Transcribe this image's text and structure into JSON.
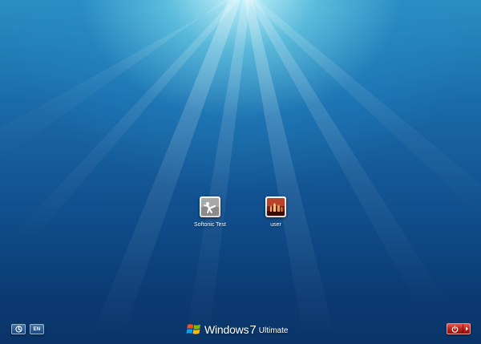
{
  "users": [
    {
      "name": "Softonic Test",
      "avatar_icon": "karate-kick-avatar-icon"
    },
    {
      "name": "user",
      "avatar_icon": "chess-pieces-avatar-icon"
    }
  ],
  "bottom_bar": {
    "ease_of_access_icon": "ease-of-access-icon",
    "language": "EN",
    "brand_windows": "Windows",
    "brand_version": "7",
    "brand_edition": "Ultimate",
    "power_icon": "power-icon",
    "power_options_icon": "arrow-right-icon"
  },
  "colors": {
    "sky_top": "#2a8fc4",
    "sky_bottom": "#0a3468",
    "glow": "#d2faff",
    "power_red": "#b3231c",
    "logo_red": "#f25022",
    "logo_green": "#7fba00",
    "logo_blue": "#00a4ef",
    "logo_yellow": "#ffb900"
  }
}
